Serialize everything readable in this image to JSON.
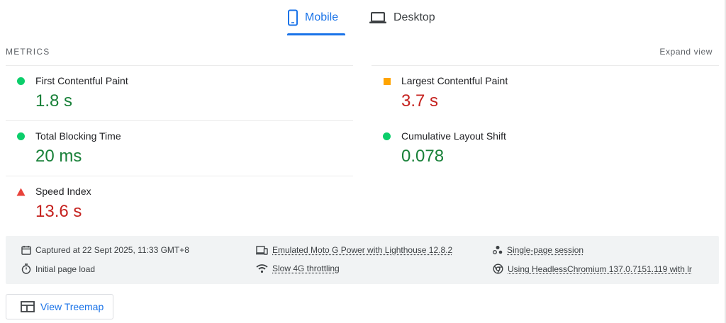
{
  "tabs": [
    {
      "label": "Mobile",
      "icon": "phone-icon",
      "selected": true
    },
    {
      "label": "Desktop",
      "icon": "laptop-icon",
      "selected": false
    }
  ],
  "metrics_section": {
    "title": "METRICS",
    "expand_label": "Expand view",
    "items": [
      {
        "name": "First Contentful Paint",
        "value": "1.8 s",
        "status": "pass",
        "indicator": "green-circle-icon"
      },
      {
        "name": "Largest Contentful Paint",
        "value": "3.7 s",
        "status": "average",
        "indicator": "orange-square-icon"
      },
      {
        "name": "Total Blocking Time",
        "value": "20 ms",
        "status": "pass",
        "indicator": "green-circle-icon"
      },
      {
        "name": "Cumulative Layout Shift",
        "value": "0.078",
        "status": "pass",
        "indicator": "green-circle-icon"
      },
      {
        "name": "Speed Index",
        "value": "13.6 s",
        "status": "fail",
        "indicator": "red-triangle-icon"
      }
    ]
  },
  "run_info": {
    "captured": "Captured at 22 Sept 2025, 11:33 GMT+8",
    "device": "Emulated Moto G Power with Lighthouse 12.8.2",
    "session": "Single-page session",
    "load": "Initial page load",
    "throttling": "Slow 4G throttling",
    "browser": "Using HeadlessChromium 137.0.7151.119 with lr"
  },
  "treemap_button": {
    "label": "View Treemap",
    "icon": "treemap-icon"
  },
  "colors": {
    "accent": "#1a73e8",
    "pass": "#0cce6b",
    "average": "#ffa400",
    "fail": "#e8423a",
    "pass_text": "#188038",
    "fail_text": "#c5221f",
    "panel_bg": "#f1f3f4"
  }
}
